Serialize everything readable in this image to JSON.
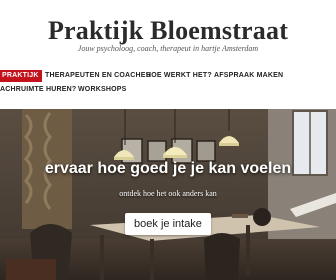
{
  "site": {
    "title": "Praktijk Bloemstraat",
    "tagline": "Jouw psycholoog, coach, therapeut in hartje Amsterdam"
  },
  "nav": {
    "items": [
      {
        "label": "PRAKTIJK",
        "active": true
      },
      {
        "label": "THERAPEUTEN EN COACHES",
        "active": false
      },
      {
        "label": "HOE WERKT HET?",
        "active": false
      },
      {
        "label": "AFSPRAAK MAKEN",
        "active": false
      },
      {
        "label": "ACHRUIMTE HUREN?",
        "active": false
      },
      {
        "label": "WORKSHOPS",
        "active": false
      }
    ]
  },
  "hero": {
    "title": "ervaar hoe goed je je kan voelen",
    "subtitle": "ontdek hoe het ook anders kan",
    "cta_label": "boek je intake"
  },
  "colors": {
    "accent": "#c4121d",
    "title_text": "#2b2b2b"
  }
}
